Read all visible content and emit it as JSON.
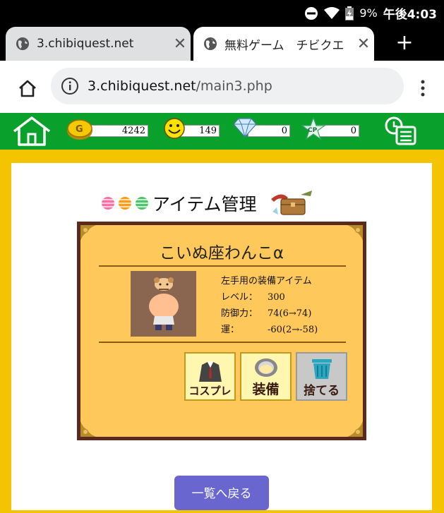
{
  "status_bar": {
    "battery": "9%",
    "time": "午後4:03",
    "icons": [
      "do-not-disturb-icon",
      "wifi-icon",
      "battery-icon"
    ]
  },
  "tabs": [
    {
      "title": "3.chibiquest.net",
      "active": false
    },
    {
      "title": "無料ゲーム　チビクエ",
      "active": true
    }
  ],
  "urlbar": {
    "host": "3.chibiquest.net",
    "path": "/main3.php"
  },
  "gamebar": {
    "gold": "4242",
    "smile": "149",
    "diamond": "0",
    "cp": "0",
    "cp_badge": "CP",
    "gold_badge": "G"
  },
  "page": {
    "title": "アイテム管理",
    "item_name": "こいぬ座わんこα",
    "stats": [
      {
        "label": "",
        "value": "左手用の装備アイテム"
      },
      {
        "label": "レベル：",
        "value": "300"
      },
      {
        "label": "防御力：",
        "value": "74(6→74)"
      },
      {
        "label": "運：",
        "value": "-60(2→-58)"
      }
    ],
    "actions": {
      "cosplay": "コスプレ",
      "equip": "装備",
      "discard": "捨てる"
    },
    "back_button": "一覧へ戻る"
  },
  "colors": {
    "game_bar": "#09a02b",
    "page_bg": "#f5c400",
    "card_bg": "#ffc85a",
    "back_button": "#6a66d0"
  }
}
